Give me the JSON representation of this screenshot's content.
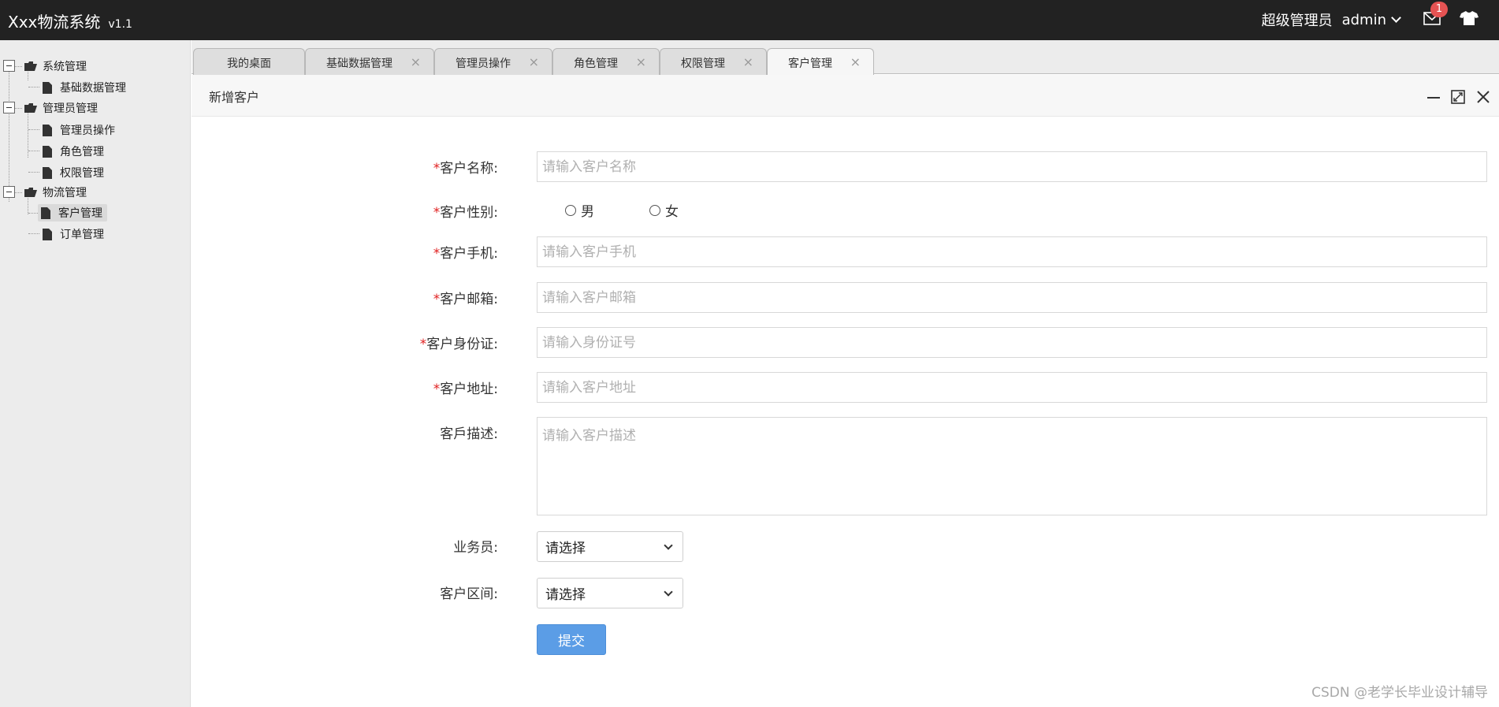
{
  "header": {
    "brand": "Xxx物流系统",
    "version": "v1.1",
    "role": "超级管理员",
    "username": "admin",
    "mail_badge": "1"
  },
  "sidebar": {
    "groups": [
      {
        "label": "系统管理",
        "items": [
          "基础数据管理"
        ]
      },
      {
        "label": "管理员管理",
        "items": [
          "管理员操作",
          "角色管理",
          "权限管理"
        ]
      },
      {
        "label": "物流管理",
        "items": [
          "客户管理",
          "订单管理"
        ]
      }
    ],
    "active_item": "客户管理"
  },
  "tabs": [
    {
      "label": "我的桌面",
      "closable": false
    },
    {
      "label": "基础数据管理",
      "closable": true
    },
    {
      "label": "管理员操作",
      "closable": true
    },
    {
      "label": "角色管理",
      "closable": true
    },
    {
      "label": "权限管理",
      "closable": true
    },
    {
      "label": "客户管理",
      "closable": true,
      "active": true
    }
  ],
  "tab_close_glyph": "×",
  "panel": {
    "title": "新增客户"
  },
  "form": {
    "required_mark": "*",
    "name_label": "客户名称:",
    "name_placeholder": "请输入客户名称",
    "gender_label": "客户性别:",
    "gender_options": [
      "男",
      "女"
    ],
    "phone_label": "客户手机:",
    "phone_placeholder": "请输入客户手机",
    "email_label": "客户邮箱:",
    "email_placeholder": "请输入客户邮箱",
    "idcard_label": "客户身份证:",
    "idcard_placeholder": "请输入身份证号",
    "address_label": "客户地址:",
    "address_placeholder": "请输入客户地址",
    "desc_label": "客戶描述:",
    "desc_placeholder": "请输入客户描述",
    "salesman_label": "业务员:",
    "salesman_value": "请选择",
    "region_label": "客户区间:",
    "region_value": "请选择",
    "submit_label": "提交"
  },
  "watermark": "CSDN @老学长毕业设计辅导",
  "colors": {
    "header_bg": "#222222",
    "accent": "#5b9de6",
    "required": "#e02020",
    "badge": "#e55353"
  }
}
